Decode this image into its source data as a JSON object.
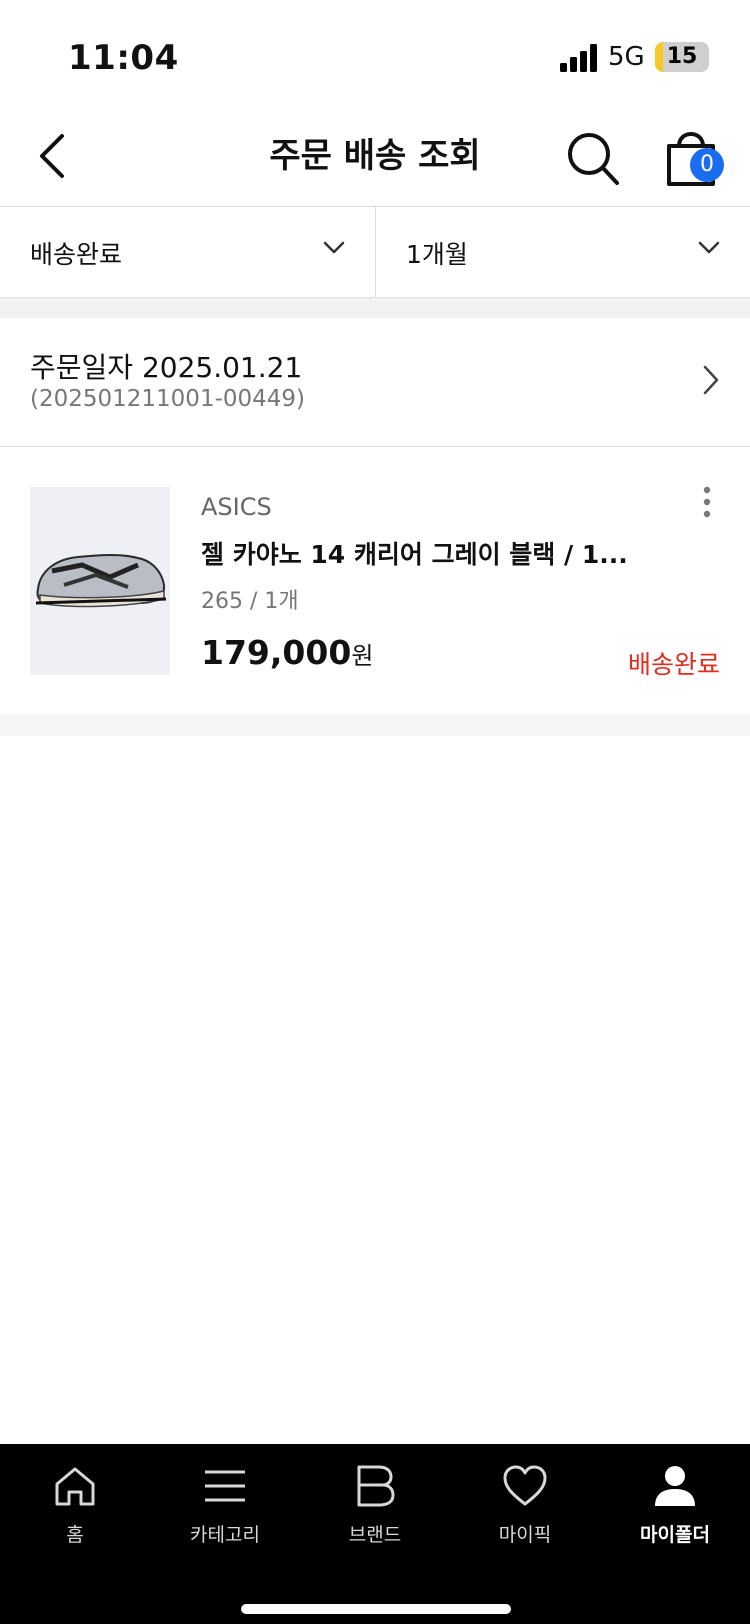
{
  "status_bar": {
    "time": "11:04",
    "network": "5G",
    "battery": "15",
    "battery_level": 0.15
  },
  "header": {
    "title": "주문 배송 조회",
    "cart_count": "0"
  },
  "filters": {
    "status": "배송완료",
    "period": "1개월"
  },
  "order": {
    "date": "주문일자 2025.01.21",
    "number": "(202501211001-00449)",
    "item": {
      "brand": "ASICS",
      "name": "젤 카야노 14 캐리어 그레이 블랙 / 1...",
      "option": "265 / 1개",
      "price": "179,000",
      "price_unit": "원",
      "status": "배송완료"
    }
  },
  "colors": {
    "accent": "#1a6df0",
    "status_red": "#e32b1f"
  },
  "bottom_nav": [
    {
      "label": "홈",
      "icon": "home-icon"
    },
    {
      "label": "카테고리",
      "icon": "menu-icon"
    },
    {
      "label": "브랜드",
      "icon": "brand-b-icon"
    },
    {
      "label": "마이픽",
      "icon": "heart-icon"
    },
    {
      "label": "마이폴더",
      "icon": "person-icon",
      "active": true
    }
  ]
}
